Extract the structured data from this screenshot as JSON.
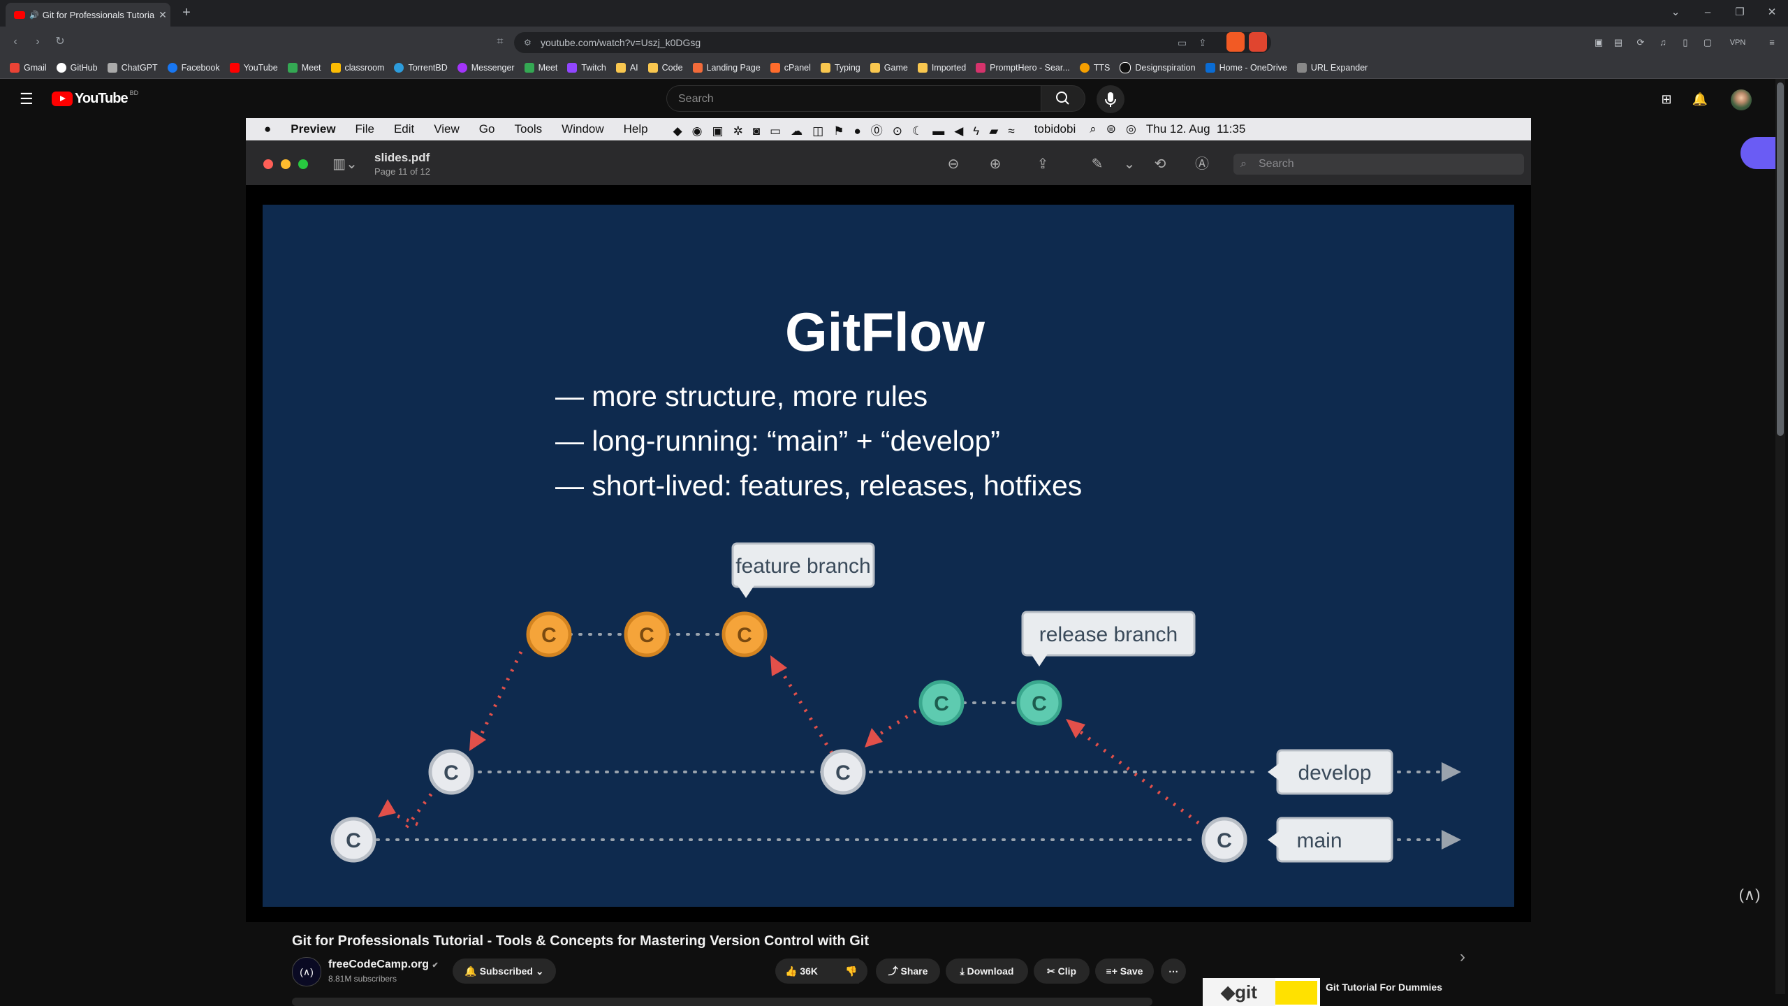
{
  "browser": {
    "tab_title": "Git for Professionals Tutorial",
    "url": "youtube.com/watch?v=Uszj_k0DGsg",
    "vpn_label": "VPN",
    "bookmarks": [
      "Gmail",
      "GitHub",
      "ChatGPT",
      "Facebook",
      "YouTube",
      "Meet",
      "classroom",
      "TorrentBD",
      "Messenger",
      "Meet",
      "Twitch",
      "AI",
      "Code",
      "Landing Page",
      "cPanel",
      "Typing",
      "Game",
      "Imported",
      "PromptHero - Sear...",
      "TTS",
      "Designspiration",
      "Home - OneDrive",
      "URL Expander"
    ]
  },
  "youtube": {
    "logo_text": "YouTube",
    "country": "BD",
    "search_placeholder": "Search"
  },
  "mac": {
    "menu": [
      "Preview",
      "File",
      "Edit",
      "View",
      "Go",
      "Tools",
      "Window",
      "Help"
    ],
    "user": "tobidobi",
    "datetime": "Thu 12. Aug  11:35"
  },
  "preview": {
    "filename": "slides.pdf",
    "page": "Page 11 of 12",
    "search_placeholder": "Search"
  },
  "slide": {
    "title": "GitFlow",
    "bullets": [
      "— more structure, more rules",
      "— long-running: “main” + “develop”",
      "— short-lived: features, releases, hotfixes"
    ],
    "labels": {
      "feature": "feature branch",
      "release": "release branch",
      "develop": "develop",
      "main": "main"
    },
    "commit_letter": "C",
    "colors": {
      "background": "#0e2a4e",
      "feature": "#f5a43a",
      "release": "#5ecbb0",
      "base": "#e8eaee",
      "arrow": "#e2504a"
    }
  },
  "video": {
    "title": "Git for Professionals Tutorial - Tools & Concepts for Mastering Version Control with Git",
    "channel": "freeCodeCamp.org",
    "verified_mark": "✔",
    "subscribers": "8.81M subscribers",
    "subscribe_label": "Subscribed",
    "likes": "36K",
    "share": "Share",
    "download": "Download",
    "clip": "Clip",
    "save": "Save",
    "recommended_title": "Git Tutorial For Dummies"
  }
}
